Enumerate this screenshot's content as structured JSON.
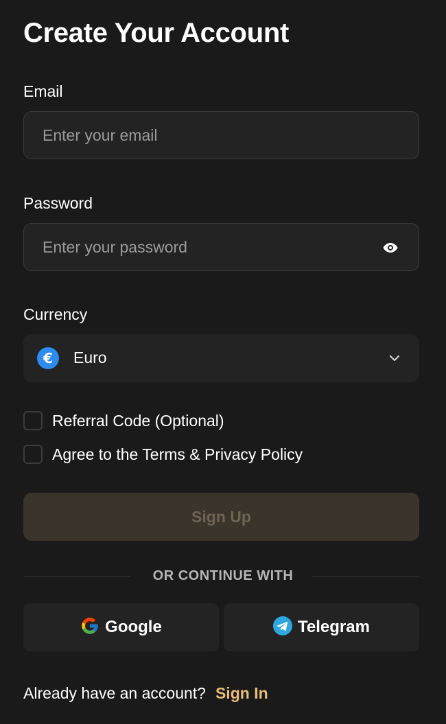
{
  "page": {
    "title": "Create Your Account"
  },
  "email": {
    "label": "Email",
    "placeholder": "Enter your email",
    "value": ""
  },
  "password": {
    "label": "Password",
    "placeholder": "Enter your password",
    "value": "",
    "toggle_icon": "eye-icon"
  },
  "currency": {
    "label": "Currency",
    "selected": "Euro",
    "icon": "euro-icon",
    "icon_glyph": "€",
    "icon_color": "#2d8cf0",
    "dropdown_icon": "chevron-down-icon"
  },
  "checkboxes": {
    "referral": {
      "label": "Referral Code (Optional)",
      "checked": false
    },
    "terms": {
      "label": "Agree to the Terms & Privacy Policy",
      "checked": false
    }
  },
  "signup": {
    "label": "Sign Up",
    "disabled": true
  },
  "divider": {
    "text": "OR CONTINUE WITH"
  },
  "social": {
    "google": {
      "label": "Google",
      "icon": "google-icon"
    },
    "telegram": {
      "label": "Telegram",
      "icon": "telegram-icon",
      "icon_color": "#2ea6e0"
    }
  },
  "footer": {
    "prompt": "Already have an account?",
    "link": "Sign In",
    "link_color": "#e8bd7a"
  },
  "colors": {
    "background": "#1a1a1a",
    "field_background": "#232323",
    "accent": "#e8bd7a",
    "button_disabled": "#3a342a"
  }
}
